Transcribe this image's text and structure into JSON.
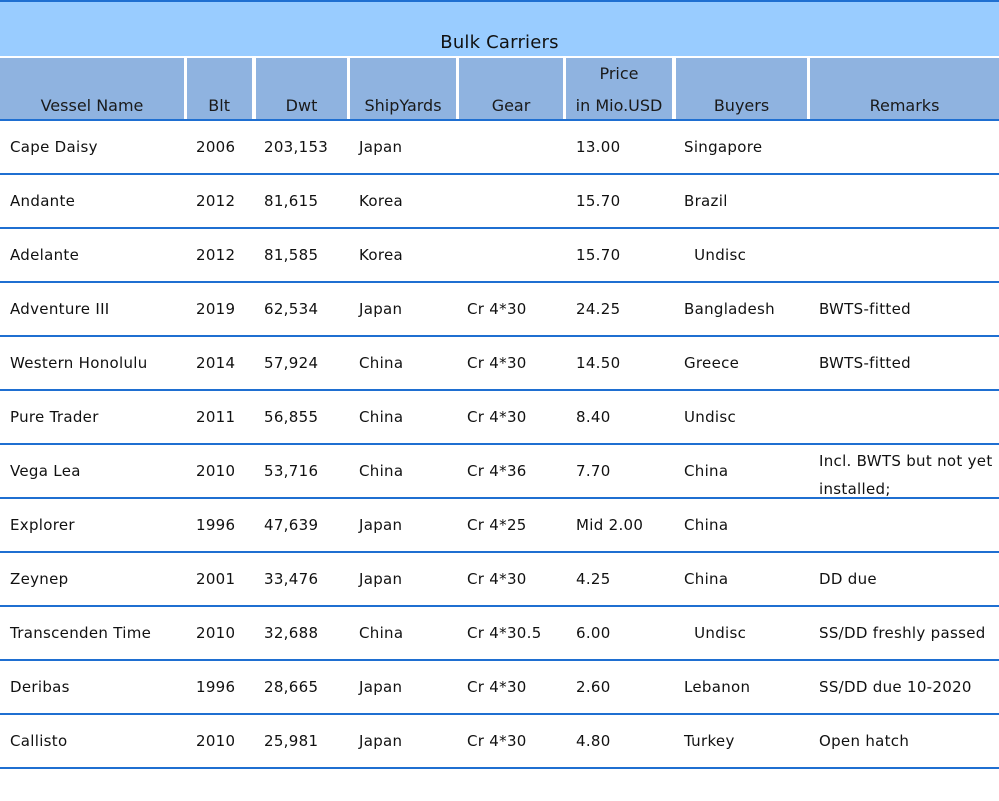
{
  "title": "Bulk Carriers",
  "headers": {
    "vessel_name": "Vessel Name",
    "blt": "Blt",
    "dwt": "Dwt",
    "shipyards": "ShipYards",
    "gear": "Gear",
    "price_top": "Price",
    "price_bottom": "in Mio.USD",
    "buyers": "Buyers",
    "remarks": "Remarks"
  },
  "rows": [
    {
      "name": "Cape Daisy",
      "blt": "2006",
      "dwt": "203,153",
      "yard": "Japan",
      "gear": "",
      "price": "13.00",
      "buyer": "Singapore",
      "remarks": ""
    },
    {
      "name": "Andante",
      "blt": "2012",
      "dwt": "81,615",
      "yard": "Korea",
      "gear": "",
      "price": "15.70",
      "buyer": "Brazil",
      "remarks": ""
    },
    {
      "name": "Adelante",
      "blt": "2012",
      "dwt": "81,585",
      "yard": "Korea",
      "gear": "",
      "price": "15.70",
      "buyer": "  Undisc",
      "remarks": ""
    },
    {
      "name": "Adventure III",
      "blt": "2019",
      "dwt": "62,534",
      "yard": "Japan",
      "gear": "Cr 4*30",
      "price": "24.25",
      "buyer": "Bangladesh",
      "remarks": "BWTS-fitted"
    },
    {
      "name": "Western Honolulu",
      "blt": "2014",
      "dwt": "57,924",
      "yard": "China",
      "gear": "Cr 4*30",
      "price": "14.50",
      "buyer": "Greece",
      "remarks": "BWTS-fitted"
    },
    {
      "name": "Pure Trader",
      "blt": "2011",
      "dwt": "56,855",
      "yard": "China",
      "gear": "Cr 4*30",
      "price": "8.40",
      "buyer": "Undisc",
      "remarks": ""
    },
    {
      "name": "Vega Lea",
      "blt": "2010",
      "dwt": "53,716",
      "yard": "China",
      "gear": "Cr 4*36",
      "price": "7.70",
      "buyer": "China",
      "remarks": "Incl. BWTS but not yet installed;"
    },
    {
      "name": "Explorer",
      "blt": "1996",
      "dwt": "47,639",
      "yard": "Japan",
      "gear": "Cr 4*25",
      "price": "Mid 2.00",
      "buyer": "China",
      "remarks": ""
    },
    {
      "name": "Zeynep",
      "blt": "2001",
      "dwt": "33,476",
      "yard": "Japan",
      "gear": "Cr 4*30",
      "price": "4.25",
      "buyer": "China",
      "remarks": "DD due"
    },
    {
      "name": "Transcenden Time",
      "blt": "2010",
      "dwt": "32,688",
      "yard": "China",
      "gear": "Cr 4*30.5",
      "price": "6.00",
      "buyer": "  Undisc",
      "remarks": "SS/DD freshly passed"
    },
    {
      "name": "Deribas",
      "blt": "1996",
      "dwt": "28,665",
      "yard": "Japan",
      "gear": "Cr 4*30",
      "price": "2.60",
      "buyer": "Lebanon",
      "remarks": "SS/DD due 10-2020"
    },
    {
      "name": "Callisto",
      "blt": "2010",
      "dwt": "25,981",
      "yard": "Japan",
      "gear": "Cr 4*30",
      "price": "4.80",
      "buyer": "Turkey",
      "remarks": "Open hatch"
    }
  ],
  "colors": {
    "title_bg": "#99ccff",
    "header_bg": "#8fb3e0",
    "rule": "#1f6fd1"
  }
}
